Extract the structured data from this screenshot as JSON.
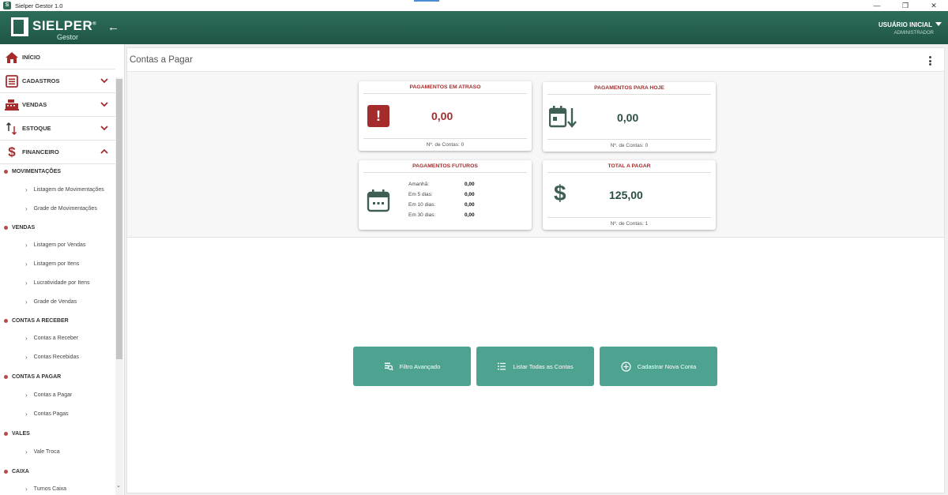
{
  "window": {
    "title": "Sielper Gestor 1.0",
    "minimize": "—",
    "restore": "❐",
    "close": "✕"
  },
  "header": {
    "logo_text": "SIELPER",
    "logo_registered": "®",
    "logo_sub": "Gestor",
    "user_name": "USUÁRIO INICIAL",
    "user_role": "ADMINISTRADOR"
  },
  "sidebar": {
    "main_items": [
      {
        "label": "INÍCIO",
        "icon": "home-icon"
      },
      {
        "label": "CADASTROS",
        "icon": "list-icon"
      },
      {
        "label": "VENDAS",
        "icon": "cash-register-icon"
      },
      {
        "label": "ESTOQUE",
        "icon": "sort-arrows-icon"
      },
      {
        "label": "FINANCEIRO",
        "icon": "dollar-icon"
      }
    ],
    "sections": [
      {
        "title": "MOVIMENTAÇÕES",
        "items": [
          "Listagem de Movimentações",
          "Grade de Movimentações"
        ]
      },
      {
        "title": "VENDAS",
        "items": [
          "Listagem por Vendas",
          "Listagem por Itens",
          "Lucratividade por Itens",
          "Grade de Vendas"
        ]
      },
      {
        "title": "CONTAS A RECEBER",
        "items": [
          "Contas a Receber",
          "Contas Recebidas"
        ]
      },
      {
        "title": "CONTAS A PAGAR",
        "items": [
          "Contas a Pagar",
          "Contas Pagas"
        ]
      },
      {
        "title": "VALES",
        "items": [
          "Vale Troca"
        ]
      },
      {
        "title": "CAIXA",
        "items": [
          "Turnos Caixa"
        ]
      }
    ]
  },
  "page": {
    "title": "Contas a Pagar"
  },
  "cards": {
    "atraso": {
      "title": "PAGAMENTOS EM ATRASO",
      "value": "0,00",
      "footer": "Nº. de Contas: 0"
    },
    "hoje": {
      "title": "PAGAMENTOS PARA HOJE",
      "value": "0,00",
      "footer": "Nº. de Contas: 0"
    },
    "futuros": {
      "title": "PAGAMENTOS FUTUROS",
      "rows": [
        {
          "label": "Amanhã:",
          "value": "0,00"
        },
        {
          "label": "Em 5 dias:",
          "value": "0,00"
        },
        {
          "label": "Em 10 dias:",
          "value": "0,00"
        },
        {
          "label": "Em 30 dias:",
          "value": "0,00"
        }
      ]
    },
    "total": {
      "title": "TOTAL A PAGAR",
      "value": "125,00",
      "footer": "Nº. de Contas: 1"
    }
  },
  "actions": {
    "filtro": "Filtro Avançado",
    "listar": "Listar Todas as Contas",
    "cadastrar": "Cadastrar Nova Conta"
  },
  "colors": {
    "header": "#1f5546",
    "accent": "#4da38f",
    "danger": "#a52c2c",
    "dark_green": "#2a4d44"
  }
}
